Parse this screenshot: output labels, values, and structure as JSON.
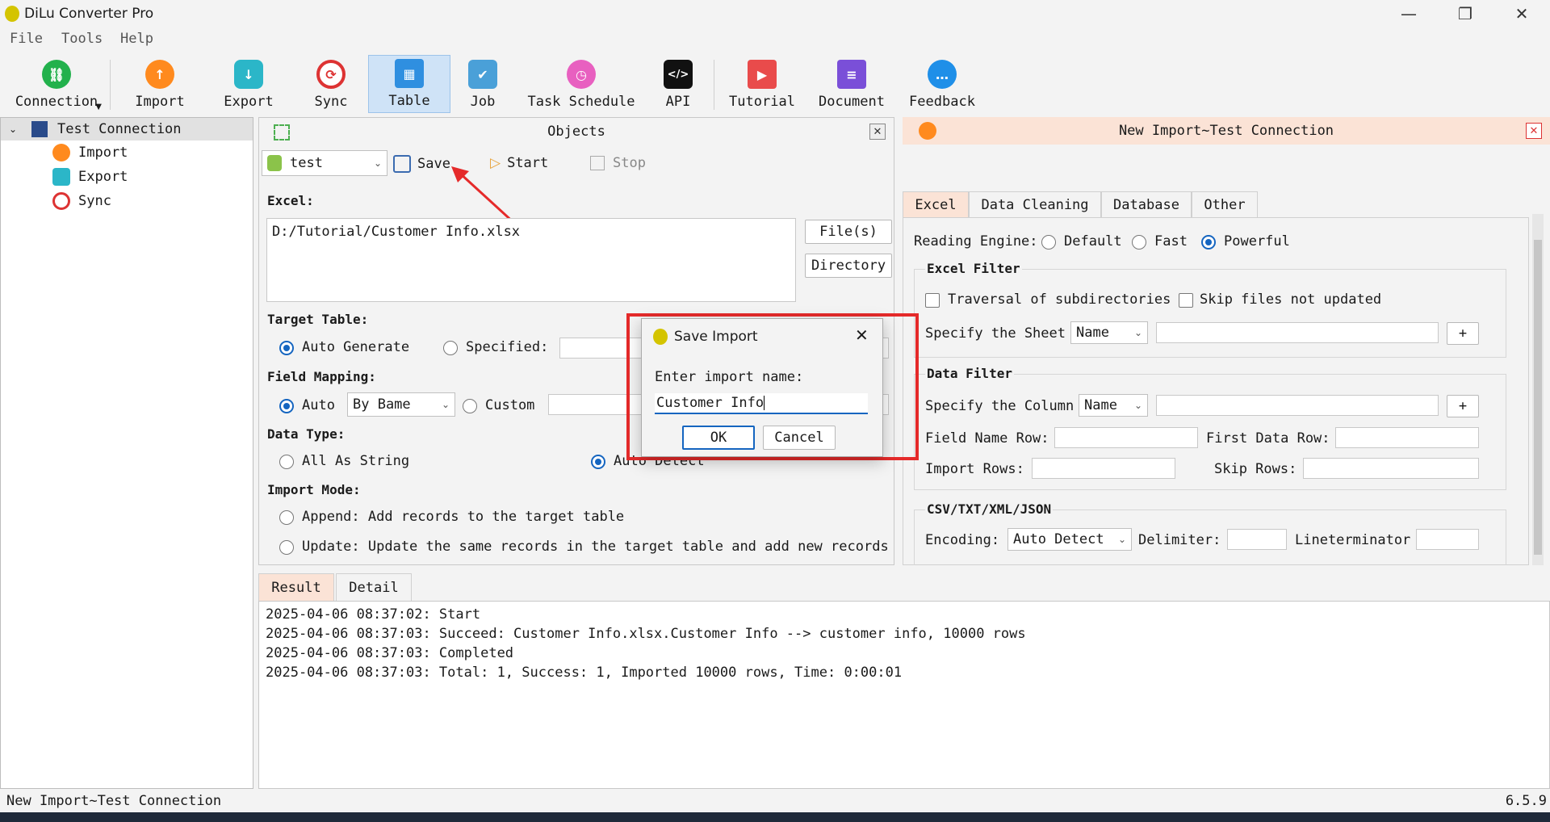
{
  "window": {
    "title": "DiLu Converter Pro",
    "minimize": "—",
    "restore": "❐",
    "close": "✕"
  },
  "menu": [
    "File",
    "Tools",
    "Help"
  ],
  "toolbar": {
    "connection": "Connection",
    "import": "Import",
    "export": "Export",
    "sync": "Sync",
    "table": "Table",
    "job": "Job",
    "task_schedule": "Task Schedule",
    "api": "API",
    "tutorial": "Tutorial",
    "document": "Document",
    "feedback": "Feedback",
    "api_icon_text": "</>"
  },
  "tree": {
    "root": "Test Connection",
    "items": [
      "Import",
      "Export",
      "Sync"
    ]
  },
  "objects": {
    "title": "Objects",
    "database": "test",
    "save": "Save",
    "start": "Start",
    "stop": "Stop",
    "excel_label": "Excel:",
    "excel_path": "D:/Tutorial/Customer Info.xlsx",
    "files_button": "File(s)",
    "directory_button": "Directory",
    "target_table_label": "Target Table:",
    "auto_generate": "Auto Generate",
    "specified": "Specified:",
    "field_mapping_label": "Field Mapping:",
    "auto": "Auto",
    "by_name": "By Bame",
    "custom": "Custom",
    "data_type_label": "Data Type:",
    "all_as_string": "All As String",
    "auto_detect": "Auto Detect",
    "import_mode_label": "Import Mode:",
    "append": "Append: Add records to the target table",
    "update": "Update: Update the same records in the target table and add new records"
  },
  "import_panel": {
    "title": "New Import~Test Connection",
    "tabs": [
      "Excel",
      "Data Cleaning",
      "Database",
      "Other"
    ],
    "reading_engine": "Reading Engine:",
    "engines": [
      "Default",
      "Fast",
      "Powerful"
    ],
    "excel_filter": "Excel Filter",
    "traversal": "Traversal of subdirectories",
    "skip_files": "Skip files not updated",
    "specify_sheet": "Specify the Sheet",
    "sheet_mode": "Name",
    "data_filter": "Data Filter",
    "specify_column": "Specify the Column",
    "column_mode": "Name",
    "field_name_row": "Field Name Row:",
    "first_data_row": "First Data Row:",
    "import_rows": "Import Rows:",
    "skip_rows": "Skip Rows:",
    "csv_group": "CSV/TXT/XML/JSON",
    "encoding": "Encoding:",
    "encoding_value": "Auto Detect",
    "delimiter": "Delimiter:",
    "lineterminator": "Lineterminator",
    "plus": "+"
  },
  "result": {
    "tabs": [
      "Result",
      "Detail"
    ],
    "log": [
      "2025-04-06 08:37:02: Start",
      "2025-04-06 08:37:03: Succeed: Customer Info.xlsx.Customer Info --> customer info, 10000 rows",
      "2025-04-06 08:37:03: Completed",
      "2025-04-06 08:37:03: Total: 1, Success: 1, Imported 10000 rows, Time: 0:00:01"
    ]
  },
  "dialog": {
    "title": "Save Import",
    "prompt": "Enter import name:",
    "value": "Customer Info",
    "ok": "OK",
    "cancel": "Cancel",
    "close": "✕"
  },
  "status": {
    "left": "New Import~Test Connection",
    "version": "6.5.9"
  },
  "colors": {
    "accent": "#1565c0",
    "highlight_red": "#e52a2a",
    "selected_tab": "#fbe3d6"
  }
}
